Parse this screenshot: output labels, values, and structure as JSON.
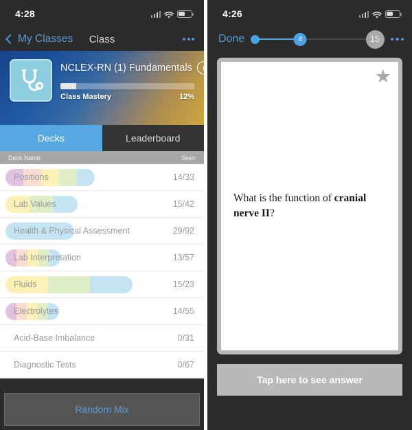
{
  "left_phone": {
    "status_bar": {
      "time": "4:28",
      "signal_icon": "cellular-signal-icon",
      "wifi_icon": "wifi-icon",
      "battery_icon": "battery-icon"
    },
    "nav": {
      "back_label": "My Classes",
      "title": "Class",
      "more_label": "•••"
    },
    "class_card": {
      "icon_name": "stethoscope-icon",
      "title": "NCLEX-RN (1) Fundamentals",
      "info_label": "i",
      "mastery_label": "Class Mastery",
      "mastery_percent": "12%",
      "mastery_value": 12
    },
    "tabs": [
      {
        "label": "Decks",
        "active": true
      },
      {
        "label": "Leaderboard",
        "active": false
      }
    ],
    "list_header": {
      "name_col": "Deck Name",
      "seen_col": "Seen"
    },
    "decks": [
      {
        "name": "Positions",
        "seen": "14/33",
        "pill_width": 130,
        "segments": [
          "#e2c2e0",
          "#fadcd2",
          "#fbf0b6",
          "#dfeec8",
          "#c5e4f3"
        ]
      },
      {
        "name": "Lab Values",
        "seen": "15/42",
        "pill_width": 105,
        "segments": [
          "#fbf0b6",
          "#dfeec8",
          "#c5e4f3"
        ]
      },
      {
        "name": "Health & Physical Assessment",
        "seen": "29/92",
        "pill_width": 100,
        "segments": [
          "#c5e4f3"
        ]
      },
      {
        "name": "Lab Interpretation",
        "seen": "13/57",
        "pill_width": 80,
        "segments": [
          "#e2c2e0",
          "#fadcd2",
          "#fbf0b6",
          "#dfeec8",
          "#c5e4f3"
        ]
      },
      {
        "name": "Fluids",
        "seen": "15/23",
        "pill_width": 185,
        "segments": [
          "#fbf0b6",
          "#dfeec8",
          "#c5e4f3"
        ]
      },
      {
        "name": "Electrolytes",
        "seen": "14/55",
        "pill_width": 78,
        "segments": [
          "#e2c2e0",
          "#fadcd2",
          "#fbf0b6",
          "#dfeec8",
          "#c5e4f3"
        ]
      },
      {
        "name": "Acid-Base Imbalance",
        "seen": "0/31",
        "pill_width": 0,
        "segments": []
      },
      {
        "name": "Diagnostic Tests",
        "seen": "0/67",
        "pill_width": 0,
        "segments": []
      }
    ],
    "bottom": {
      "random_mix_label": "Random Mix"
    }
  },
  "right_phone": {
    "status_bar": {
      "time": "4:26",
      "signal_icon": "cellular-signal-icon",
      "wifi_icon": "wifi-icon",
      "battery_icon": "battery-icon"
    },
    "nav": {
      "done_label": "Done",
      "current_card": "4",
      "total_cards": "15",
      "progress_percent": 37,
      "more_label": "•••"
    },
    "card": {
      "star_icon": "star-icon",
      "star_glyph": "★",
      "question_prefix": "What is the function of ",
      "question_bold": "cranial nerve II",
      "question_suffix": "?"
    },
    "answer": {
      "label": "Tap here to see answer"
    }
  },
  "colors": {
    "accent_blue": "#56a8e0",
    "link_blue": "#5b9bd5",
    "dark_chrome": "#2b2b2b",
    "gray_button": "#b9b9b9"
  }
}
